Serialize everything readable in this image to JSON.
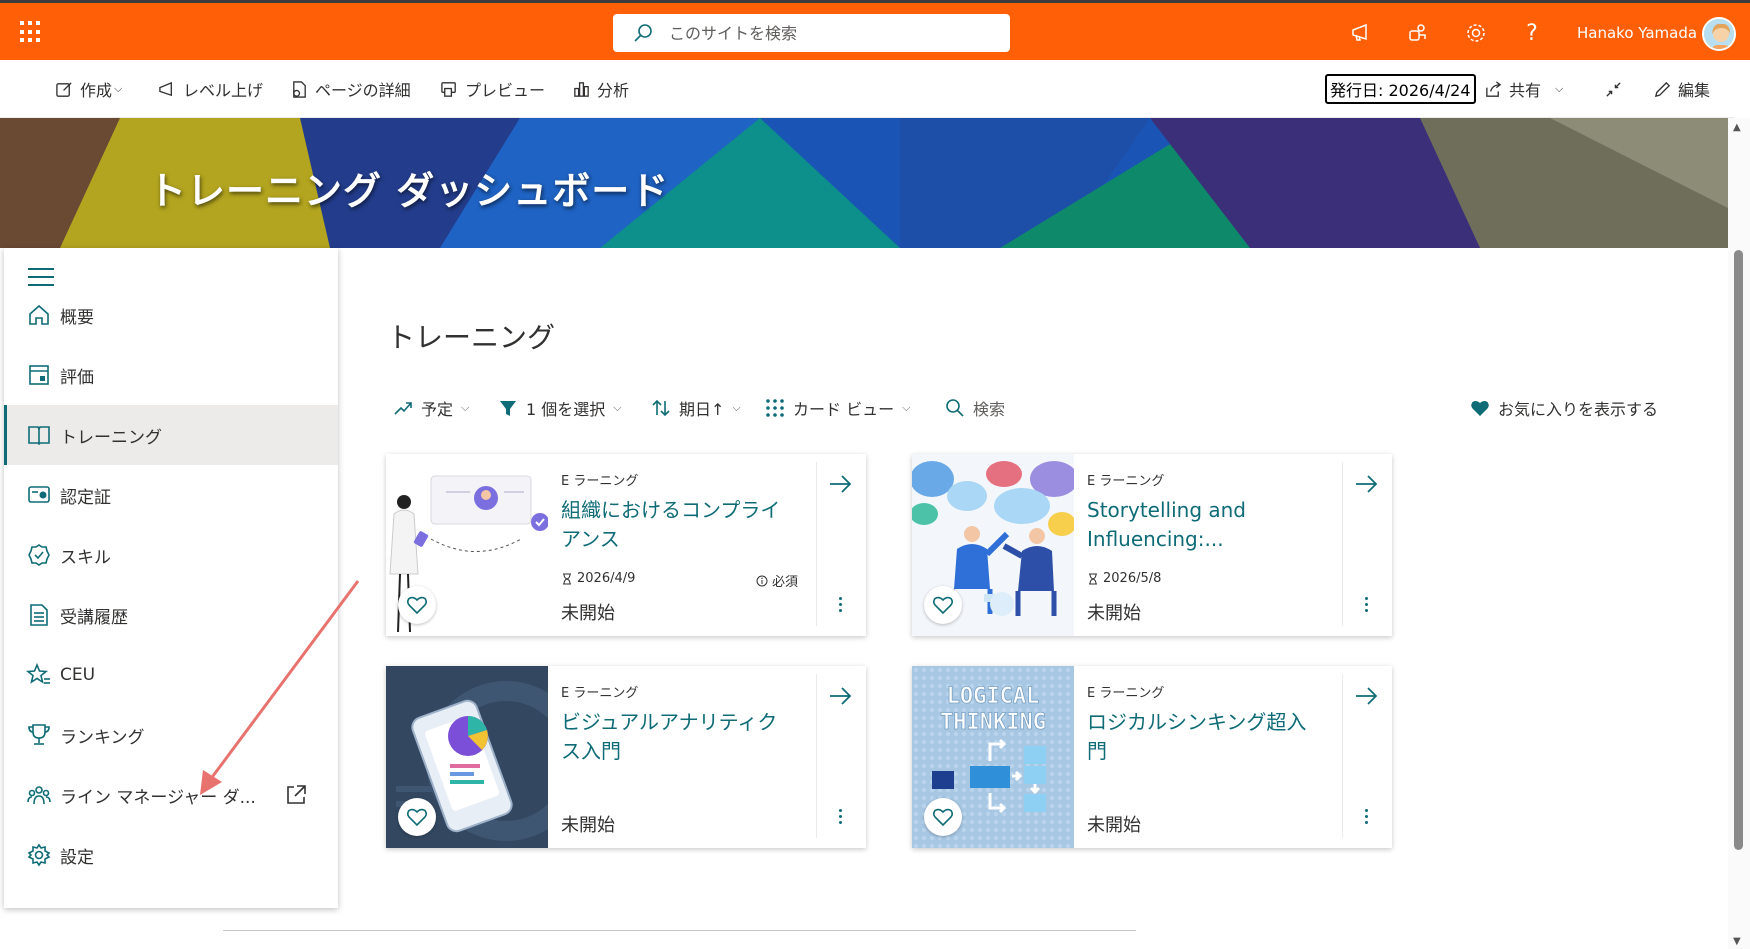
{
  "suitebar": {
    "search_placeholder": "このサイトを検索",
    "user_name": "Hanako Yamada",
    "help_label": "?",
    "accent_color": "#ff5f06"
  },
  "commandbar": {
    "new_label": "作成",
    "promote_label": "レベル上げ",
    "page_details_label": "ページの詳細",
    "preview_label": "プレビュー",
    "analytics_label": "分析",
    "publish_date": "発行日: 2026/4/24",
    "share_label": "共有",
    "edit_label": "編集"
  },
  "hero": {
    "title": "トレーニング ダッシュボード"
  },
  "nav": {
    "items": [
      {
        "label": "概要",
        "icon": "home-icon"
      },
      {
        "label": "評価",
        "icon": "calendar-icon"
      },
      {
        "label": "トレーニング",
        "icon": "book-icon",
        "active": true
      },
      {
        "label": "認定証",
        "icon": "certificate-icon"
      },
      {
        "label": "スキル",
        "icon": "badge-icon"
      },
      {
        "label": "受講履歴",
        "icon": "document-list-icon"
      },
      {
        "label": "CEU",
        "icon": "star-list-icon"
      },
      {
        "label": "ランキング",
        "icon": "trophy-icon"
      },
      {
        "label": "ライン マネージャー ダ...",
        "icon": "people-team-icon",
        "external": true
      },
      {
        "label": "設定",
        "icon": "settings-icon"
      }
    ]
  },
  "main": {
    "heading": "トレーニング",
    "filters": {
      "schedule": "予定",
      "selected": "1 個を選択",
      "sort": "期日↑",
      "view": "カード ビュー",
      "search": "検索"
    },
    "show_favorites": "お気に入りを表示する",
    "cards": [
      {
        "category": "E ラーニング",
        "title": "組織におけるコンプライアンス",
        "date": "2026/4/9",
        "required": "必須",
        "status": "未開始"
      },
      {
        "category": "E ラーニング",
        "title": "Storytelling and Influencing:...",
        "date": "2026/5/8",
        "status": "未開始"
      },
      {
        "category": "E ラーニング",
        "title": "ビジュアルアナリティクス入門",
        "status": "未開始"
      },
      {
        "category": "E ラーニング",
        "title": "ロジカルシンキング超入門",
        "status": "未開始",
        "thumb_text": [
          "LOGICAL",
          "THINKING"
        ]
      }
    ]
  }
}
